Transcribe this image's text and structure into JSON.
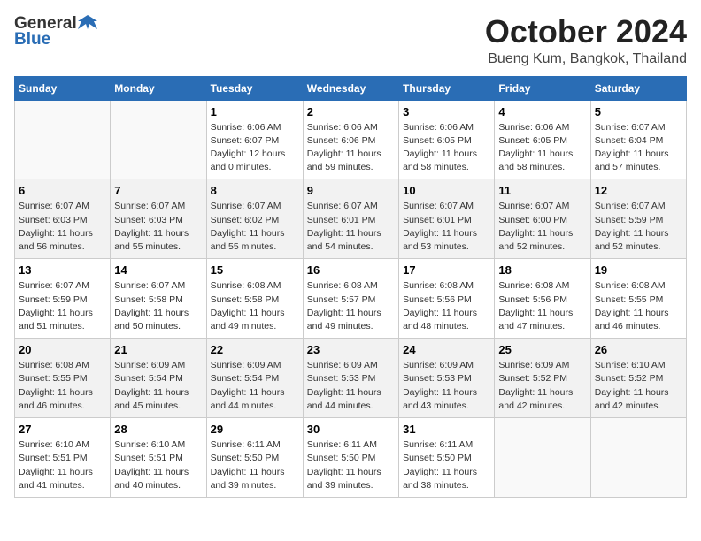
{
  "logo": {
    "general": "General",
    "blue": "Blue"
  },
  "title": "October 2024",
  "location": "Bueng Kum, Bangkok, Thailand",
  "days_of_week": [
    "Sunday",
    "Monday",
    "Tuesday",
    "Wednesday",
    "Thursday",
    "Friday",
    "Saturday"
  ],
  "weeks": [
    [
      {
        "day": "",
        "info": ""
      },
      {
        "day": "",
        "info": ""
      },
      {
        "day": "1",
        "info": "Sunrise: 6:06 AM\nSunset: 6:07 PM\nDaylight: 12 hours\nand 0 minutes."
      },
      {
        "day": "2",
        "info": "Sunrise: 6:06 AM\nSunset: 6:06 PM\nDaylight: 11 hours\nand 59 minutes."
      },
      {
        "day": "3",
        "info": "Sunrise: 6:06 AM\nSunset: 6:05 PM\nDaylight: 11 hours\nand 58 minutes."
      },
      {
        "day": "4",
        "info": "Sunrise: 6:06 AM\nSunset: 6:05 PM\nDaylight: 11 hours\nand 58 minutes."
      },
      {
        "day": "5",
        "info": "Sunrise: 6:07 AM\nSunset: 6:04 PM\nDaylight: 11 hours\nand 57 minutes."
      }
    ],
    [
      {
        "day": "6",
        "info": "Sunrise: 6:07 AM\nSunset: 6:03 PM\nDaylight: 11 hours\nand 56 minutes."
      },
      {
        "day": "7",
        "info": "Sunrise: 6:07 AM\nSunset: 6:03 PM\nDaylight: 11 hours\nand 55 minutes."
      },
      {
        "day": "8",
        "info": "Sunrise: 6:07 AM\nSunset: 6:02 PM\nDaylight: 11 hours\nand 55 minutes."
      },
      {
        "day": "9",
        "info": "Sunrise: 6:07 AM\nSunset: 6:01 PM\nDaylight: 11 hours\nand 54 minutes."
      },
      {
        "day": "10",
        "info": "Sunrise: 6:07 AM\nSunset: 6:01 PM\nDaylight: 11 hours\nand 53 minutes."
      },
      {
        "day": "11",
        "info": "Sunrise: 6:07 AM\nSunset: 6:00 PM\nDaylight: 11 hours\nand 52 minutes."
      },
      {
        "day": "12",
        "info": "Sunrise: 6:07 AM\nSunset: 5:59 PM\nDaylight: 11 hours\nand 52 minutes."
      }
    ],
    [
      {
        "day": "13",
        "info": "Sunrise: 6:07 AM\nSunset: 5:59 PM\nDaylight: 11 hours\nand 51 minutes."
      },
      {
        "day": "14",
        "info": "Sunrise: 6:07 AM\nSunset: 5:58 PM\nDaylight: 11 hours\nand 50 minutes."
      },
      {
        "day": "15",
        "info": "Sunrise: 6:08 AM\nSunset: 5:58 PM\nDaylight: 11 hours\nand 49 minutes."
      },
      {
        "day": "16",
        "info": "Sunrise: 6:08 AM\nSunset: 5:57 PM\nDaylight: 11 hours\nand 49 minutes."
      },
      {
        "day": "17",
        "info": "Sunrise: 6:08 AM\nSunset: 5:56 PM\nDaylight: 11 hours\nand 48 minutes."
      },
      {
        "day": "18",
        "info": "Sunrise: 6:08 AM\nSunset: 5:56 PM\nDaylight: 11 hours\nand 47 minutes."
      },
      {
        "day": "19",
        "info": "Sunrise: 6:08 AM\nSunset: 5:55 PM\nDaylight: 11 hours\nand 46 minutes."
      }
    ],
    [
      {
        "day": "20",
        "info": "Sunrise: 6:08 AM\nSunset: 5:55 PM\nDaylight: 11 hours\nand 46 minutes."
      },
      {
        "day": "21",
        "info": "Sunrise: 6:09 AM\nSunset: 5:54 PM\nDaylight: 11 hours\nand 45 minutes."
      },
      {
        "day": "22",
        "info": "Sunrise: 6:09 AM\nSunset: 5:54 PM\nDaylight: 11 hours\nand 44 minutes."
      },
      {
        "day": "23",
        "info": "Sunrise: 6:09 AM\nSunset: 5:53 PM\nDaylight: 11 hours\nand 44 minutes."
      },
      {
        "day": "24",
        "info": "Sunrise: 6:09 AM\nSunset: 5:53 PM\nDaylight: 11 hours\nand 43 minutes."
      },
      {
        "day": "25",
        "info": "Sunrise: 6:09 AM\nSunset: 5:52 PM\nDaylight: 11 hours\nand 42 minutes."
      },
      {
        "day": "26",
        "info": "Sunrise: 6:10 AM\nSunset: 5:52 PM\nDaylight: 11 hours\nand 42 minutes."
      }
    ],
    [
      {
        "day": "27",
        "info": "Sunrise: 6:10 AM\nSunset: 5:51 PM\nDaylight: 11 hours\nand 41 minutes."
      },
      {
        "day": "28",
        "info": "Sunrise: 6:10 AM\nSunset: 5:51 PM\nDaylight: 11 hours\nand 40 minutes."
      },
      {
        "day": "29",
        "info": "Sunrise: 6:11 AM\nSunset: 5:50 PM\nDaylight: 11 hours\nand 39 minutes."
      },
      {
        "day": "30",
        "info": "Sunrise: 6:11 AM\nSunset: 5:50 PM\nDaylight: 11 hours\nand 39 minutes."
      },
      {
        "day": "31",
        "info": "Sunrise: 6:11 AM\nSunset: 5:50 PM\nDaylight: 11 hours\nand 38 minutes."
      },
      {
        "day": "",
        "info": ""
      },
      {
        "day": "",
        "info": ""
      }
    ]
  ]
}
